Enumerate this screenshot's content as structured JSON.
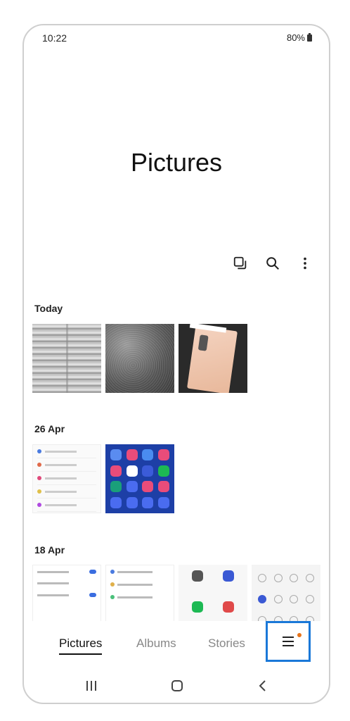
{
  "status_bar": {
    "time": "10:22",
    "battery": "80%"
  },
  "page_title": "Pictures",
  "toolbar": {
    "icons": [
      "select-icon",
      "search-icon",
      "more-options-icon"
    ]
  },
  "sections": [
    {
      "title": "Today"
    },
    {
      "title": "26 Apr"
    },
    {
      "title": "18 Apr"
    }
  ],
  "bottom_nav": {
    "tabs": [
      {
        "label": "Pictures",
        "active": true
      },
      {
        "label": "Albums",
        "active": false
      },
      {
        "label": "Stories",
        "active": false
      }
    ],
    "menu_icon": "hamburger-menu-icon",
    "notification_color": "#e8741a",
    "highlight_color": "#1a78d8"
  },
  "system_nav": {
    "icons": [
      "recent-apps-icon",
      "home-icon",
      "back-icon"
    ]
  }
}
